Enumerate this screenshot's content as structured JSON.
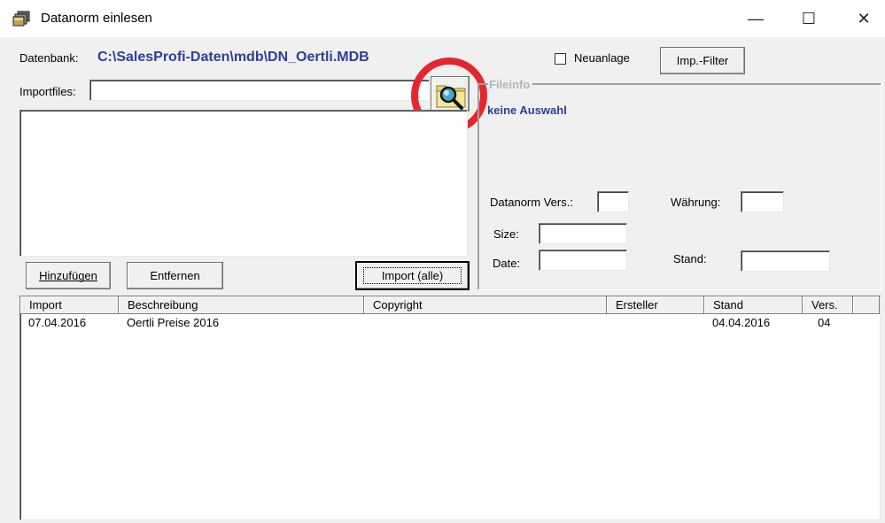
{
  "window": {
    "title": "Datanorm einlesen",
    "minimize_glyph": "—",
    "maximize_glyph": "☐",
    "close_glyph": "✕"
  },
  "database": {
    "label": "Datenbank:",
    "path": "C:\\SalesProfi-Daten\\mdb\\DN_Oertli.MDB"
  },
  "neuanlage": {
    "label": "Neuanlage",
    "checked": false
  },
  "imp_filter_button": "Imp.-Filter",
  "importfiles": {
    "label": "Importfiles:",
    "value": ""
  },
  "buttons": {
    "hinzufuegen": "Hinzufügen",
    "entfernen": "Entfernen",
    "import_alle": "Import (alle)"
  },
  "fileinfo": {
    "legend": "Fileinfo",
    "status": "keine Auswahl",
    "datanorm_vers_label": "Datanorm Vers.:",
    "datanorm_vers_value": "",
    "waehrung_label": "Währung:",
    "waehrung_value": "",
    "size_label": "Size:",
    "size_value": "",
    "date_label": "Date:",
    "date_value": "",
    "stand_label": "Stand:",
    "stand_value": ""
  },
  "table": {
    "columns": [
      "Import",
      "Beschreibung",
      "Copyright",
      "Ersteller",
      "Stand",
      "Vers."
    ],
    "rows": [
      [
        "07.04.2016",
        "Oertli Preise 2016",
        "",
        "",
        "04.04.2016",
        "04"
      ]
    ]
  },
  "colors": {
    "accent_text": "#2c3e9a",
    "highlight_circle": "#e6262d",
    "dialog_bg": "#f0f0f0"
  },
  "icons": {
    "app": "folder-stack-icon",
    "browse": "magnifier-folder-icon"
  }
}
